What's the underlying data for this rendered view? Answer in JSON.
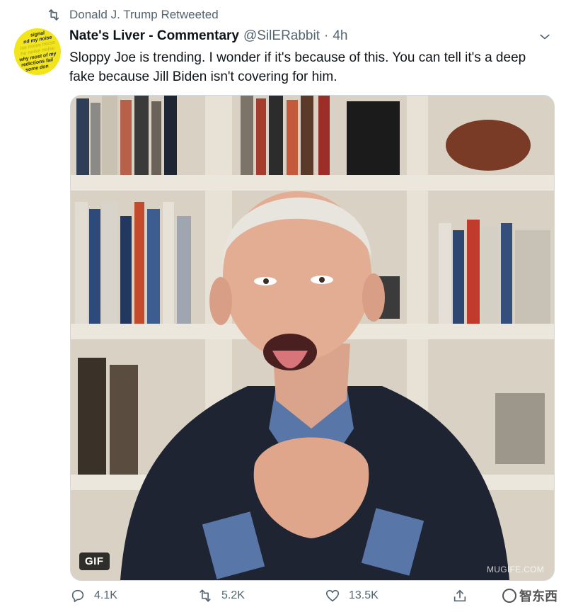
{
  "retweet": {
    "label": "Donald J. Trump Retweeted",
    "icon": "retweet-icon"
  },
  "author": {
    "display_name": "Nate's Liver - Commentary",
    "handle": "@SilERabbit",
    "separator": "·",
    "time": "4h",
    "avatar_lines": [
      "signal",
      "nd my noise",
      "ise noise noise",
      "he noise noise",
      "why most of my",
      "redictions fail",
      "some don"
    ]
  },
  "tweet": {
    "text": "Sloppy Joe is trending. I wonder if it's because of this. You can tell it's a deep fake because Jill Biden isn't covering for him."
  },
  "media": {
    "badge": "GIF",
    "watermark": "MUGIFE.COM"
  },
  "actions": {
    "reply_count": "4.1K",
    "retweet_count": "5.2K",
    "like_count": "13.5K"
  },
  "site_logo": {
    "text": "智东西"
  },
  "colors": {
    "text_primary": "#0f1419",
    "text_secondary": "#536471",
    "avatar_bg": "#f2e51d",
    "border": "#cfd9de"
  }
}
